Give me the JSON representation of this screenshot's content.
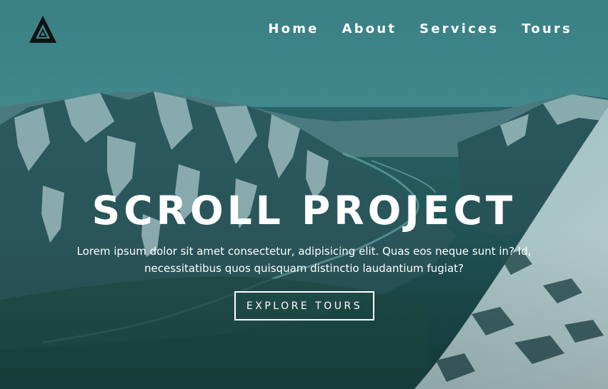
{
  "header": {
    "logo_icon": "triangle-logo-icon",
    "nav": [
      {
        "label": "Home"
      },
      {
        "label": "About"
      },
      {
        "label": "Services"
      },
      {
        "label": "Tours"
      }
    ]
  },
  "hero": {
    "title": "SCROLL PROJECT",
    "description": "Lorem ipsum dolor sit amet consectetur, adipisicing elit. Quas eos neque sunt in? Id, necessitatibus quos quisquam distinctio laudantium fugiat?",
    "cta_label": "EXPLORE TOURS",
    "background_image": "mountain-valley-photo"
  },
  "colors": {
    "text": "#ffffff",
    "overlay_teal": "#2f6a70"
  }
}
